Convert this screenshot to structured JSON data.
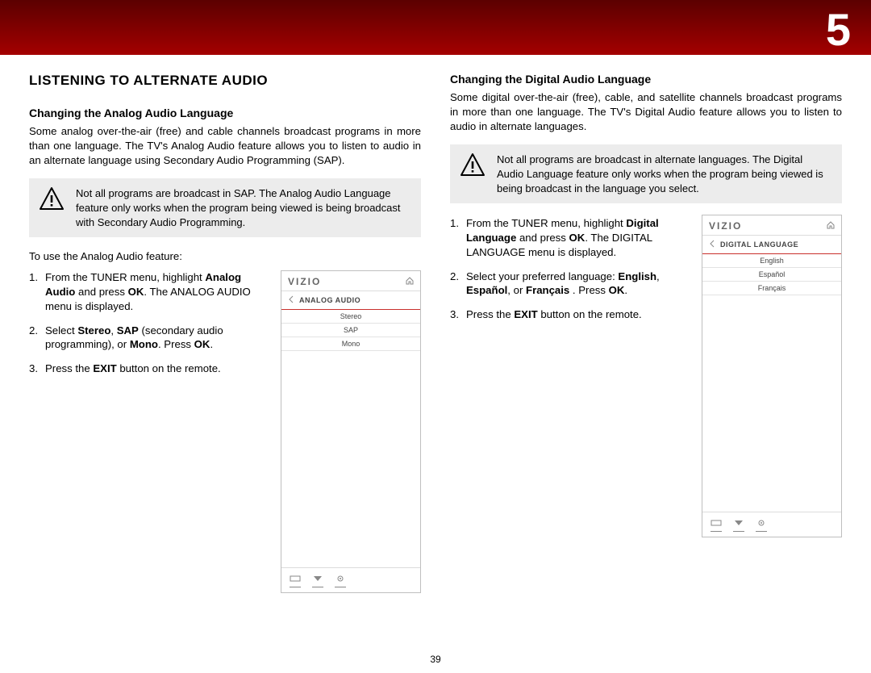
{
  "chapter_number": "5",
  "page_number": "39",
  "section_title": "LISTENING TO ALTERNATE AUDIO",
  "left": {
    "subheading": "Changing the Analog Audio Language",
    "intro": "Some analog over-the-air (free) and cable channels broadcast programs in more than one language. The TV's Analog Audio feature allows you to listen to audio in an alternate language using Secondary Audio Programming (SAP).",
    "note": "Not all programs are broadcast in SAP. The Analog Audio Language feature only works when the program being viewed is being broadcast with Secondary Audio Programming.",
    "lead": "To use the Analog Audio feature:",
    "step1_a": "From the TUNER menu, highlight ",
    "step1_b": "Analog Audio",
    "step1_c": " and press ",
    "step1_d": "OK",
    "step1_e": ". The ANALOG AUDIO menu is displayed.",
    "step2_a": "Select ",
    "step2_b": "Stereo",
    "step2_c": ", ",
    "step2_d": "SAP",
    "step2_e": " (secondary audio programming), or ",
    "step2_f": "Mono",
    "step2_g": ". Press ",
    "step2_h": "OK",
    "step2_i": ".",
    "step3_a": "Press the ",
    "step3_b": "EXIT",
    "step3_c": " button on the remote.",
    "tv": {
      "brand": "VIZIO",
      "menu_title": "ANALOG AUDIO",
      "items": [
        "Stereo",
        "SAP",
        "Mono"
      ]
    }
  },
  "right": {
    "subheading": "Changing the Digital Audio Language",
    "intro": "Some digital over-the-air (free), cable, and satellite channels broadcast programs in more than one language. The TV's Digital Audio feature allows you to listen to audio in alternate languages.",
    "note": "Not all programs are broadcast in alternate languages. The Digital Audio Language feature only works when the program being viewed is being broadcast in the language you select.",
    "step1_a": "From the TUNER menu, highlight ",
    "step1_b": "Digital Language",
    "step1_c": " and press ",
    "step1_d": "OK",
    "step1_e": ". The DIGITAL LANGUAGE menu is displayed.",
    "step2_a": "Select your preferred language: ",
    "step2_b": "English",
    "step2_c": ", ",
    "step2_d": "Español",
    "step2_e": ",  or ",
    "step2_f": "Français",
    "step2_g": " . Press ",
    "step2_h": "OK",
    "step2_i": ".",
    "step3_a": "Press the ",
    "step3_b": "EXIT",
    "step3_c": " button on the remote.",
    "tv": {
      "brand": "VIZIO",
      "menu_title": "DIGITAL LANGUAGE",
      "items": [
        "English",
        "Español",
        "Français"
      ]
    }
  }
}
